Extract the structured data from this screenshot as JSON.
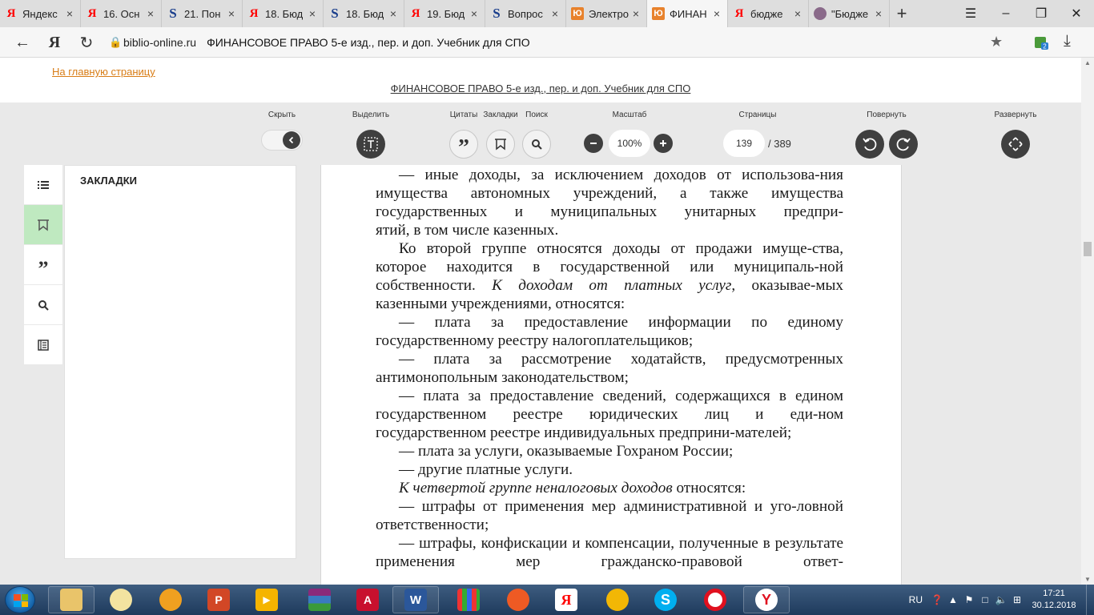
{
  "browser": {
    "tabs": [
      {
        "label": "Яндекс",
        "favicon": "yandex-icon",
        "active": false
      },
      {
        "label": "16. Осн",
        "favicon": "yandex-icon",
        "active": false
      },
      {
        "label": "21. Пон",
        "favicon": "studfiles-icon",
        "active": false
      },
      {
        "label": "18. Бюд",
        "favicon": "yandex-icon",
        "active": false
      },
      {
        "label": "18. Бюд",
        "favicon": "studfiles-icon",
        "active": false
      },
      {
        "label": "19. Бюд",
        "favicon": "yandex-icon",
        "active": false
      },
      {
        "label": "Вопрос",
        "favicon": "studfiles-icon",
        "active": false
      },
      {
        "label": "Электро",
        "favicon": "urait-icon",
        "active": false
      },
      {
        "label": "ФИНАН",
        "favicon": "urait-icon",
        "active": true
      },
      {
        "label": "бюдже",
        "favicon": "yandex-icon",
        "active": false
      },
      {
        "label": "\"Бюдже",
        "favicon": "avatar-icon",
        "active": false
      }
    ],
    "domain": "biblio-online.ru",
    "page_title": "ФИНАНСОВОЕ ПРАВО 5-е изд., пер. и доп. Учебник для СПО"
  },
  "page": {
    "home_link": "На главную страницу",
    "book_title": "ФИНАНСОВОЕ ПРАВО 5-е изд., пер. и доп. Учебник для СПО"
  },
  "toolbar": {
    "hide_label": "Скрыть",
    "select_label": "Выделить",
    "quotes_label": "Цитаты",
    "bookmarks_label": "Закладки",
    "search_label": "Поиск",
    "zoom_label": "Масштаб",
    "zoom_value": "100%",
    "pages_label": "Страницы",
    "current_page": "139",
    "total_pages": "/ 389",
    "rotate_label": "Повернуть",
    "expand_label": "Развернуть"
  },
  "sidebar": {
    "panel_title": "ЗАКЛАДКИ",
    "items": [
      {
        "icon": "list-icon",
        "active": false
      },
      {
        "icon": "bookmark-icon",
        "active": true
      },
      {
        "icon": "quote-icon",
        "active": false
      },
      {
        "icon": "search-icon",
        "active": false
      },
      {
        "icon": "book-icon",
        "active": false
      }
    ]
  },
  "book_page": {
    "paragraphs": [
      "— иные доходы, за исключением доходов от использова-ния имущества автономных учреждений, а также имущества государственных и муниципальных унитарных предпри-",
      "ятий, в том числе казенных.",
      "Ко второй группе относятся доходы от продажи имуще-ства, которое находится в государственной или муниципаль-ной собственности.",
      "К доходам от платных услуг",
      ", оказывае-мых казенными учреждениями, относятся:",
      "— плата за предоставление информации по единому государственному реестру налогоплательщиков;",
      "— плата за рассмотрение ходатайств, предусмотренных антимонопольным законодательством;",
      "— плата за предоставление сведений, содержащихся в едином государственном реестре юридических лиц и еди-ном государственном реестре индивидуальных предприни-мателей;",
      "— плата за услуги, оказываемые Гохраном России;",
      "— другие платные услуги.",
      "К четвертой группе неналоговых доходов",
      " относятся:",
      "— штрафы от применения мер административной и уго-ловной ответственности;",
      "— штрафы, конфискации и компенсации, полученные в результате применения мер гражданско-правовой ответ-"
    ]
  },
  "taskbar": {
    "apps": [
      "explorer",
      "yandex-browser-alt",
      "media",
      "powerpoint",
      "video",
      "winrar",
      "acrobat",
      "word",
      "apps-grid",
      "media-player",
      "yandex",
      "headphones",
      "skype",
      "opera",
      "yandex-browser"
    ],
    "language": "RU",
    "time": "17:21",
    "date": "30.12.2018"
  }
}
